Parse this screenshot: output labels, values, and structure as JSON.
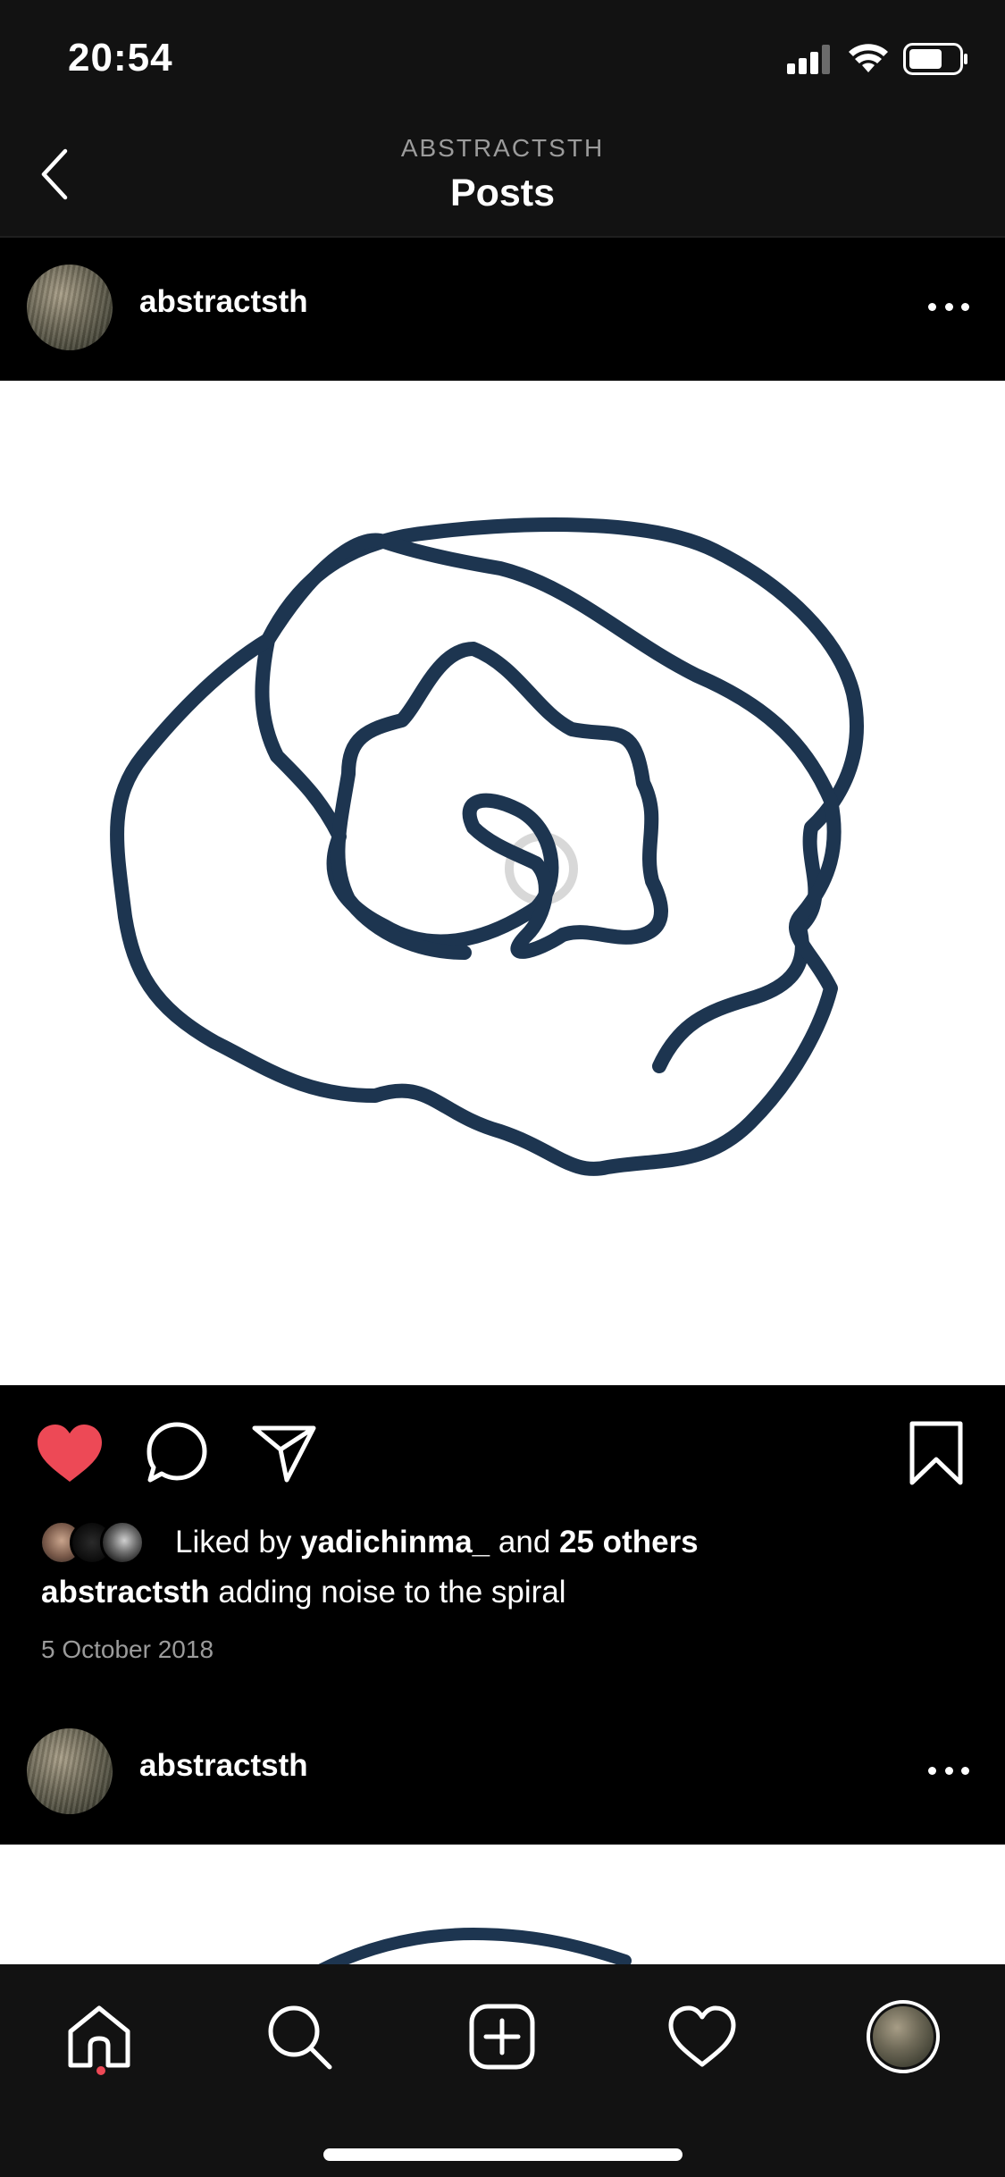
{
  "status_bar": {
    "time": "20:54",
    "icons": [
      "cellular-signal-icon",
      "wifi-icon",
      "battery-icon"
    ]
  },
  "nav": {
    "subtitle": "ABSTRACTSTH",
    "title": "Posts",
    "back_icon": "chevron-left-icon"
  },
  "posts": [
    {
      "username": "abstractsth",
      "more_icon": "more-horizontal-icon",
      "liked": true,
      "likes": {
        "prefix": "Liked by",
        "user": "yadichinma_",
        "joiner": "and",
        "others": "25 others"
      },
      "caption": {
        "username": "abstractsth",
        "text": "adding noise to the spiral"
      },
      "date": "5 October 2018"
    },
    {
      "username": "abstractsth",
      "more_icon": "more-horizontal-icon"
    }
  ],
  "action_icons": [
    "heart-icon",
    "comment-icon",
    "share-icon",
    "bookmark-icon"
  ],
  "tab_bar": {
    "tabs": [
      "home-icon",
      "search-icon",
      "new-post-icon",
      "activity-icon",
      "profile-icon"
    ],
    "active": "home-icon"
  },
  "colors": {
    "like_red": "#ed4956",
    "drawing_stroke": "#1d3550",
    "bar_background": "#121212"
  }
}
